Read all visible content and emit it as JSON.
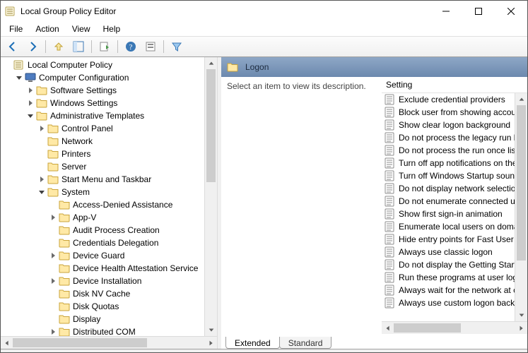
{
  "title": "Local Group Policy Editor",
  "menu": [
    "File",
    "Action",
    "View",
    "Help"
  ],
  "toolbar_icons": [
    "back",
    "forward",
    "up",
    "show-hide-tree",
    "export-list",
    "refresh",
    "help",
    "properties",
    "filter"
  ],
  "tree": [
    {
      "d": 0,
      "icon": "gp",
      "exp": "none",
      "label": "Local Computer Policy"
    },
    {
      "d": 1,
      "icon": "comp",
      "exp": "open",
      "label": "Computer Configuration"
    },
    {
      "d": 2,
      "icon": "folder",
      "exp": "closed",
      "label": "Software Settings"
    },
    {
      "d": 2,
      "icon": "folder",
      "exp": "closed",
      "label": "Windows Settings"
    },
    {
      "d": 2,
      "icon": "folder",
      "exp": "open",
      "label": "Administrative Templates"
    },
    {
      "d": 3,
      "icon": "folder",
      "exp": "closed",
      "label": "Control Panel"
    },
    {
      "d": 3,
      "icon": "folder",
      "exp": "none",
      "label": "Network"
    },
    {
      "d": 3,
      "icon": "folder",
      "exp": "none",
      "label": "Printers"
    },
    {
      "d": 3,
      "icon": "folder",
      "exp": "none",
      "label": "Server"
    },
    {
      "d": 3,
      "icon": "folder",
      "exp": "closed",
      "label": "Start Menu and Taskbar"
    },
    {
      "d": 3,
      "icon": "folder",
      "exp": "open",
      "label": "System"
    },
    {
      "d": 4,
      "icon": "folder",
      "exp": "none",
      "label": "Access-Denied Assistance"
    },
    {
      "d": 4,
      "icon": "folder",
      "exp": "closed",
      "label": "App-V"
    },
    {
      "d": 4,
      "icon": "folder",
      "exp": "none",
      "label": "Audit Process Creation"
    },
    {
      "d": 4,
      "icon": "folder",
      "exp": "none",
      "label": "Credentials Delegation"
    },
    {
      "d": 4,
      "icon": "folder",
      "exp": "closed",
      "label": "Device Guard"
    },
    {
      "d": 4,
      "icon": "folder",
      "exp": "none",
      "label": "Device Health Attestation Service"
    },
    {
      "d": 4,
      "icon": "folder",
      "exp": "closed",
      "label": "Device Installation"
    },
    {
      "d": 4,
      "icon": "folder",
      "exp": "none",
      "label": "Disk NV Cache"
    },
    {
      "d": 4,
      "icon": "folder",
      "exp": "none",
      "label": "Disk Quotas"
    },
    {
      "d": 4,
      "icon": "folder",
      "exp": "none",
      "label": "Display"
    },
    {
      "d": 4,
      "icon": "folder",
      "exp": "closed",
      "label": "Distributed COM"
    }
  ],
  "detail": {
    "title": "Logon",
    "desc_prompt": "Select an item to view its description.",
    "col_header": "Setting",
    "items": [
      "Exclude credential providers",
      "Block user from showing account details",
      "Show clear logon background",
      "Do not process the legacy run list",
      "Do not process the run once list",
      "Turn off app notifications on the lock screen",
      "Turn off Windows Startup sound",
      "Do not display network selection UI",
      "Do not enumerate connected users on domain",
      "Show first sign-in animation",
      "Enumerate local users on domain-joined",
      "Hide entry points for Fast User Switching",
      "Always use classic logon",
      "Do not display the Getting Started welcome",
      "Run these programs at user logon",
      "Always wait for the network at computer",
      "Always use custom logon background"
    ],
    "tabs": [
      "Extended",
      "Standard"
    ]
  }
}
